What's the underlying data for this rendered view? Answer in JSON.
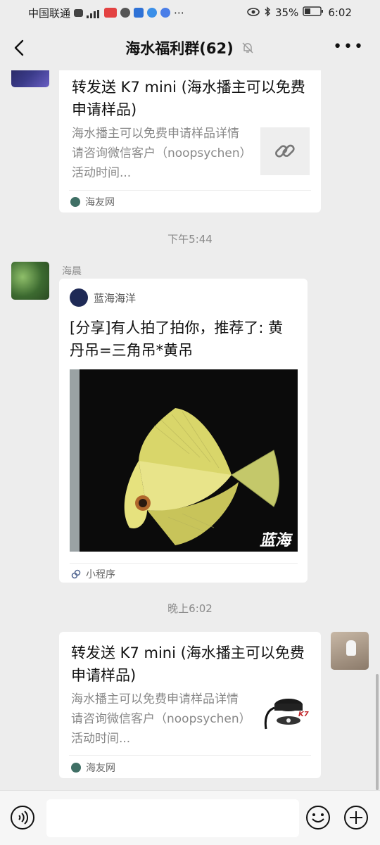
{
  "status_bar": {
    "carrier": "中国联通",
    "battery": "35%",
    "time": "6:02"
  },
  "header": {
    "title": "海水福利群(62)"
  },
  "messages": [
    {
      "card_title": "转发送 K7 mini (海水播主可以免费申请样品)",
      "card_desc": "海水播主可以免费申请样品详情请咨询微信客户（noopsychen）活动时间...",
      "source": "海友网"
    },
    {
      "timestamp": "下午5:44"
    },
    {
      "sender": "海晨",
      "app_name": "蓝海海洋",
      "card_title": "[分享]有人拍了拍你，推荐了: 黄丹吊=三角吊*黄吊",
      "watermark": "蓝海",
      "source": "小程序"
    },
    {
      "timestamp": "晚上6:02"
    },
    {
      "card_title": "转发送 K7 mini (海水播主可以免费申请样品)",
      "card_desc": "海水播主可以免费申请样品详情请咨询微信客户（noopsychen）活动时间...",
      "thumb_logo": "K7",
      "source": "海友网"
    }
  ],
  "colors": {
    "background": "#ededed",
    "card": "#ffffff",
    "muted_text": "#888888",
    "mini_program_icon": "#576b95",
    "haiyou_icon": "#3f6f65"
  },
  "icons": [
    "back-arrow-icon",
    "mute-bell-icon",
    "more-icon",
    "link-icon",
    "voice-icon",
    "emoji-icon",
    "plus-icon"
  ]
}
